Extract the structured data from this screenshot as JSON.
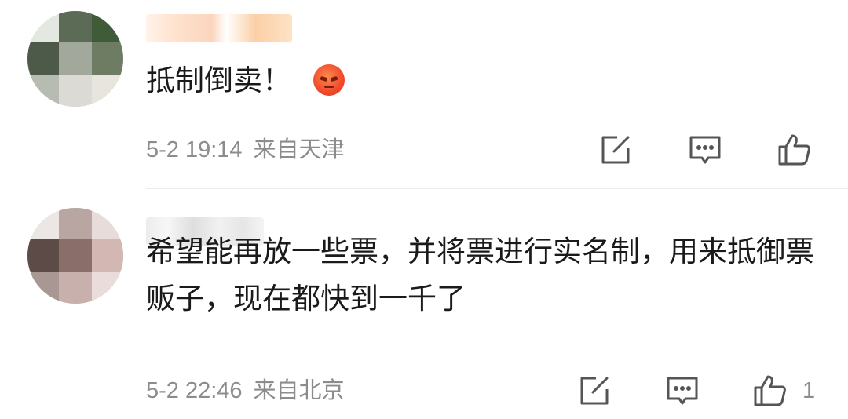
{
  "comments": [
    {
      "text": "抵制倒卖！",
      "emoji": "angry-face",
      "time": "5-2 19:14",
      "location": "来自天津",
      "likes": ""
    },
    {
      "text": "希望能再放一些票，并将票进行实名制，用来抵御票贩子，现在都快到一千了",
      "time": "5-2 22:46",
      "location": "来自北京",
      "likes": "1"
    }
  ],
  "icons": {
    "share": "share-icon",
    "comment": "comment-icon",
    "like": "thumbs-up-icon"
  },
  "colors": {
    "text": "#1a1a1a",
    "meta": "#8c8c8c",
    "icon": "#555555",
    "emoji": "#f04a2a"
  }
}
